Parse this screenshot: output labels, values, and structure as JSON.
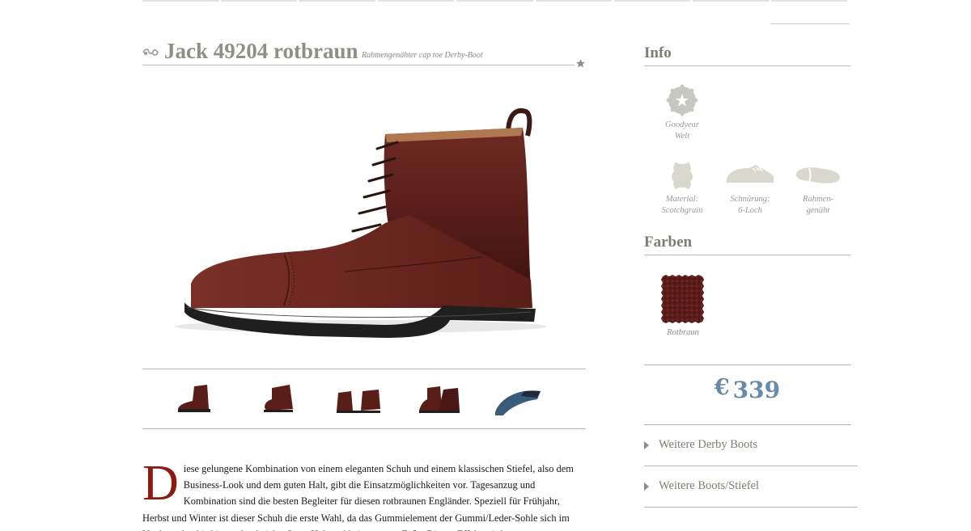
{
  "product": {
    "title": "Jack 49204 rotbraun",
    "subtitle": "Rahmengenähter cap toe Derby-Boot"
  },
  "thumbnails": [
    {
      "name": "side-view"
    },
    {
      "name": "heel-view"
    },
    {
      "name": "pair-angle"
    },
    {
      "name": "pair-front"
    },
    {
      "name": "sole-view"
    }
  ],
  "description": {
    "dropcap": "D",
    "text": "iese gelungene Kombination von einem eleganten Schuh und einem klassischen Stiefel, also dem Business-Look und dem guten Halt, gibt die Einsatzmöglichkeiten vor. Tagesanzug und Kombination sind die besten Begleiter für diesen rotbraunen Engländer. Speziell für Frühjahr, Herbst und Winter ist dieser Schuh die erste Wahl, da das Gummielement der Gummi/Leder-Sohle sich im Vorderpoden bis hinten durchzieht. Guter Halt und keine nassen Füße. Diesen Effekt wird"
  },
  "info": {
    "heading": "Info",
    "items": [
      {
        "line1": "Goodyear",
        "line2": "Welt",
        "icon": "badge-star-icon"
      },
      {
        "line1": "Material:",
        "line2": "Scotchgrain",
        "icon": "leather-hide-icon"
      },
      {
        "line1": "Schnürung:",
        "line2": "6-Loch",
        "icon": "shoe-lacing-icon"
      },
      {
        "line1": "Rahmen-",
        "line2": "genäht",
        "icon": "sole-welt-icon"
      }
    ]
  },
  "colors": {
    "heading": "Farben",
    "items": [
      {
        "label": "Rotbraun",
        "hex": "#5a1c18"
      }
    ]
  },
  "price": {
    "currency": "€",
    "amount": "339"
  },
  "links": [
    {
      "label": "Weitere Derby Boots"
    },
    {
      "label": "Weitere Boots/Stiefel"
    }
  ],
  "theme": {
    "accent": "#8b1a10",
    "price": "#6a8aa6",
    "muted": "#8f8f86"
  }
}
